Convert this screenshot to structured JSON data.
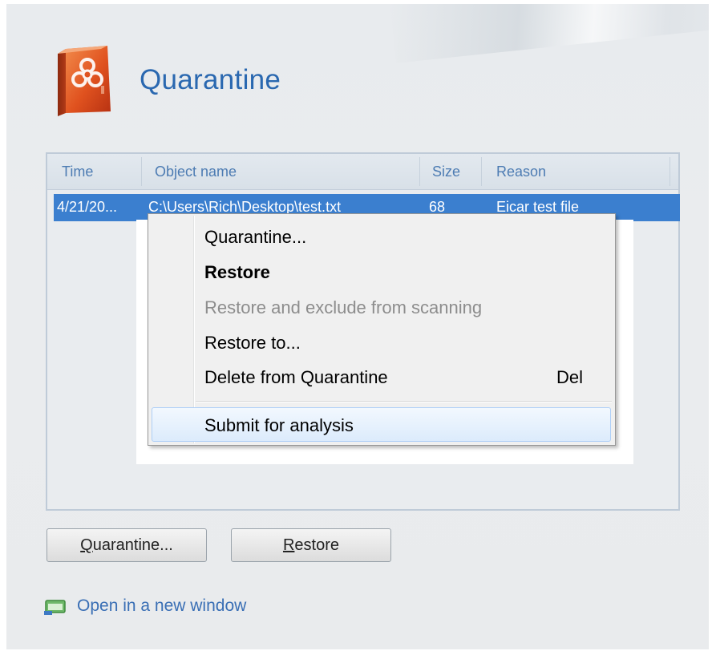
{
  "header": {
    "title": "Quarantine",
    "logo_icon": "biohazard-box-icon"
  },
  "table": {
    "columns": [
      "Time",
      "Object name",
      "Size",
      "Reason"
    ],
    "rows": [
      {
        "time": "4/21/20...",
        "object_name": "C:\\Users\\Rich\\Desktop\\test.txt",
        "size": "68",
        "reason": "Eicar test file"
      }
    ]
  },
  "context_menu": {
    "items": [
      {
        "label": "Quarantine...",
        "style": "normal"
      },
      {
        "label": "Restore",
        "style": "bold"
      },
      {
        "label": "Restore and exclude from scanning",
        "style": "disabled"
      },
      {
        "label": "Restore to...",
        "style": "normal"
      },
      {
        "label": "Delete from Quarantine",
        "style": "normal",
        "shortcut": "Del"
      },
      {
        "label": "Submit for analysis",
        "style": "hover"
      }
    ]
  },
  "buttons": {
    "quarantine": {
      "mnemonic": "Q",
      "rest": "uarantine..."
    },
    "restore": {
      "mnemonic": "R",
      "rest": "estore"
    }
  },
  "footer": {
    "open_window_label": "Open in a new window",
    "open_window_icon": "new-window-icon"
  },
  "colors": {
    "accent": "#2a68b0",
    "selection": "#3b7fcf",
    "logo": "#d9461c"
  }
}
